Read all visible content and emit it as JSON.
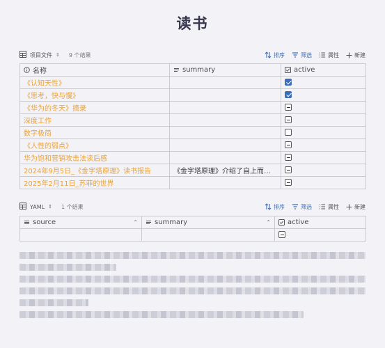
{
  "page": {
    "title": "读书"
  },
  "base1": {
    "view_name": "项目文件",
    "count": "9 个结果",
    "actions": {
      "sort": "排序",
      "filter": "筛选",
      "properties": "属性",
      "new": "新建"
    },
    "columns": {
      "name": "名称",
      "summary": "summary",
      "active": "active"
    },
    "rows": [
      {
        "name": "《认知天性》",
        "summary": "",
        "active": "checked"
      },
      {
        "name": "《思考，快与慢》",
        "summary": "",
        "active": "checked"
      },
      {
        "name": "《华为的冬天》摘录",
        "summary": "",
        "active": "indeterminate"
      },
      {
        "name": "深度工作",
        "summary": "",
        "active": "indeterminate"
      },
      {
        "name": "数字极简",
        "summary": "",
        "active": "unchecked"
      },
      {
        "name": "《人性的弱点》",
        "summary": "",
        "active": "indeterminate"
      },
      {
        "name": "华为饱和营销攻击法读后感",
        "summary": "",
        "active": "indeterminate"
      },
      {
        "name": "2024年9月5日_《金字塔原理》读书报告",
        "summary": "《金字塔原理》介绍了自上而…",
        "active": "indeterminate"
      },
      {
        "name": "2025年2月11日_苏菲的世界",
        "summary": "",
        "active": "indeterminate"
      }
    ]
  },
  "base2": {
    "view_name": "YAML",
    "count": "1 个结果",
    "actions": {
      "sort": "排序",
      "filter": "筛选",
      "properties": "属性",
      "new": "新建"
    },
    "columns": {
      "source": "source",
      "summary": "summary",
      "active": "active"
    },
    "rows": [
      {
        "source": "",
        "summary": "",
        "active": "indeterminate"
      }
    ]
  },
  "colors": {
    "link": "#e9a33b",
    "accent": "#3b6db8"
  }
}
